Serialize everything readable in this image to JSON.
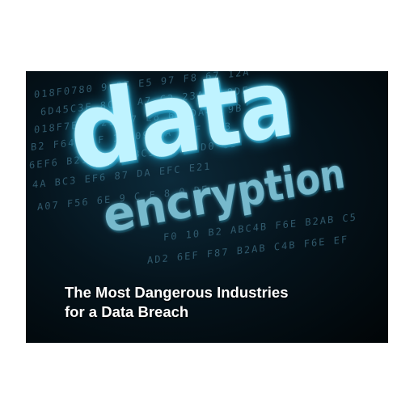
{
  "image": {
    "headline_word": "data",
    "subheadline_word": "encryption",
    "caption": {
      "line1": "The Most Dangerous Industries",
      "line2": "for a Data Breach"
    },
    "hex_rows": [
      "018F0780  9  07  E5  97  F8  67  12A",
      "6D45C3E  8C  4  A7  C2  23ABE 8DF",
      "018F7EF  F21  07  E8  67  DA4F  9B",
      "B2  F64A  3F  10  09  4A  7EF  8C3",
      "6EF6  B21  1291  BC3A  F7  6D0  8B",
      "4A  BC3  EF6  87  DA  EFC  E21",
      "A07  F56  6E  9  C  F  8  0  DE",
      "F0  10  B2  ABC4B  F6E  B2AB  C5",
      "AD2  6EF  F87  B2AB  C4B  F6E  EF"
    ],
    "colors": {
      "headline": "#bff3ff",
      "subheadline": "#77b9cc",
      "background": "#05141d",
      "caption": "#ffffff"
    }
  }
}
